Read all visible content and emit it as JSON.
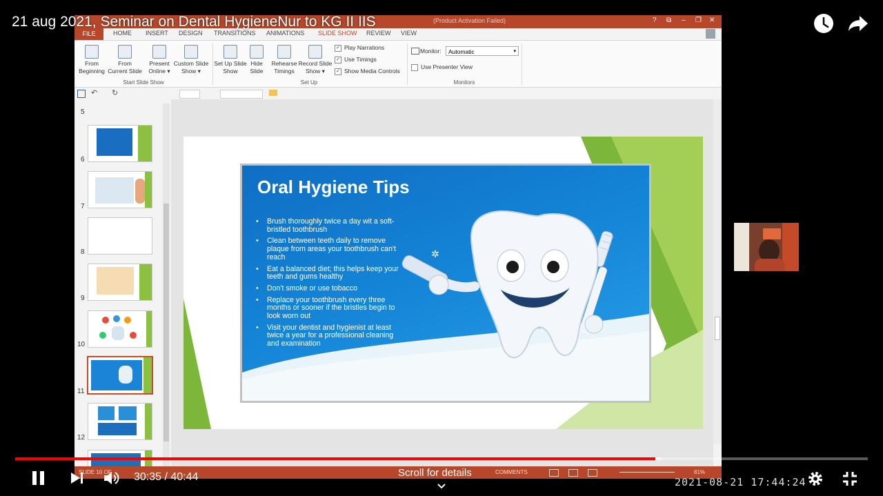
{
  "video": {
    "title": "21 aug 2021, Seminar on Dental HygieneNur to KG II IIS",
    "time_display": "30:35 / 40:44",
    "progress_fraction": 0.751,
    "scroll_hint": "Scroll for details",
    "overlay_timestamp": "2021-08-21 17:44:24",
    "icons": {
      "watch_later": "clock-icon",
      "share": "share-icon",
      "pause": "pause-icon",
      "next": "next-icon",
      "volume": "volume-icon",
      "settings": "gear-icon",
      "exit_fullscreen": "exit-fullscreen-icon",
      "chevron": "chevron-down-icon"
    },
    "accent_color": "#ff0000"
  },
  "ppt": {
    "title_status": "(Product Activation Failed)",
    "window_controls": [
      "?",
      "⧉",
      "–",
      "❐",
      "✕"
    ],
    "tabs": [
      "FILE",
      "HOME",
      "INSERT",
      "DESIGN",
      "TRANSITIONS",
      "ANIMATIONS",
      "SLIDE SHOW",
      "REVIEW",
      "VIEW"
    ],
    "active_tab": "SLIDE SHOW",
    "ribbon": {
      "start_group_label": "Start Slide Show",
      "from_beginning": "From Beginning",
      "from_current": "From Current Slide",
      "present_online": "Present Online ▾",
      "custom_show": "Custom Slide Show ▾",
      "setup_group_label": "Set Up",
      "setup_show": "Set Up Slide Show",
      "hide_slide": "Hide Slide",
      "rehearse": "Rehearse Timings",
      "record": "Record Slide Show ▾",
      "play_narrations": "Play Narrations",
      "use_timings": "Use Timings",
      "show_media": "Show Media Controls",
      "monitors_group_label": "Monitors",
      "monitor_label": "Monitor:",
      "monitor_value": "Automatic",
      "presenter_view": "Use Presenter View"
    },
    "thumbnail_numbers": [
      "5",
      "6",
      "7",
      "8",
      "9",
      "10",
      "11",
      "12"
    ],
    "selected_slide": "10",
    "status_left": "SLIDE 10 OF",
    "status_comments": "COMMENTS",
    "status_zoom": "81%",
    "brand_color": "#b7472a"
  },
  "slide": {
    "title": "Oral Hygiene Tips",
    "bullets": [
      "Brush thoroughly twice a day wit a soft-bristled toothbrush",
      "Clean between teeth daily to remove plaque from areas your toothbrush can't reach",
      "Eat a balanced diet; this helps keep your teeth and gums healthy",
      "Don't smoke or use tobacco",
      "Replace your toothbrush every three months or sooner if the bristles begin to look worn out",
      "Visit your dentist and hygienist at least twice a year for a professional cleaning and examination"
    ]
  }
}
